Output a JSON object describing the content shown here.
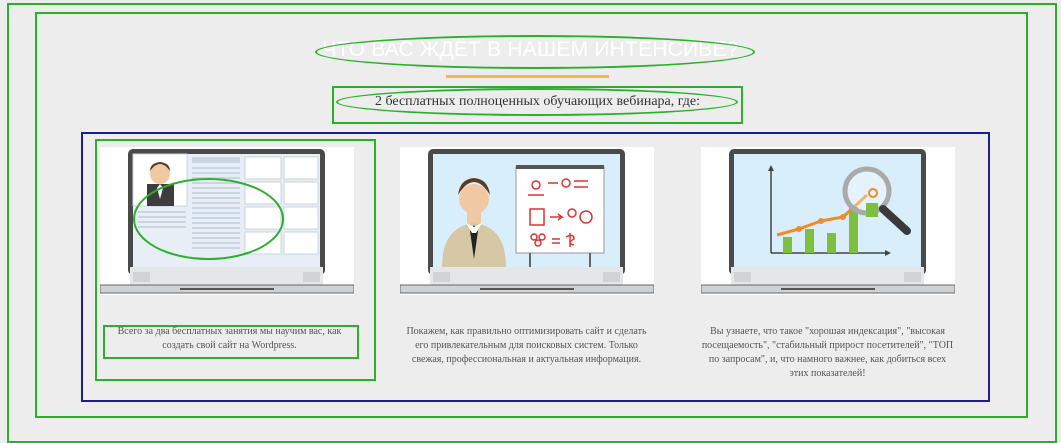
{
  "section": {
    "title": "ЧТО ВАС ЖДЁТ В НАШЕМ ИНТЕНСИВЕ?",
    "subtitle": "2 бесплатных полноценных обучающих вебинара, где:"
  },
  "cards": [
    {
      "illustration": "laptop-video-lesson-icon",
      "text": "Всего за два бесплатных занятия мы научим вас, как создать свой сайт на Wordpress."
    },
    {
      "illustration": "laptop-presenter-whiteboard-icon",
      "text": "Покажем, как правильно оптимизировать сайт и сделать его привлекательным для поисковых систем. Только свежая, профессиональная и актуальная информация."
    },
    {
      "illustration": "laptop-growth-chart-icon",
      "text": "Вы узнаете, что такое \"хорошая индексация\", \"высокая посещаемость\", \"стабильный прирост посетителей\", \"ТОП по запросам\", и, что намного важнее, как добиться всех этих показателей!"
    }
  ],
  "colors": {
    "background": "#ededed",
    "annotation_green": "#2bb02b",
    "annotation_navy": "#1a1f8c",
    "title_underline": "#f0b84a"
  }
}
